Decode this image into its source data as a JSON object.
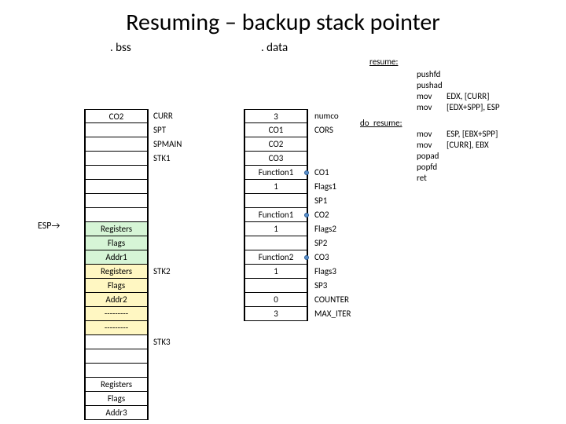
{
  "title": "Resuming – backup stack pointer",
  "sections": {
    "bss": ". bss",
    "data": ". data"
  },
  "esp": "ESP→",
  "bss_cells": [
    {
      "v": "CO2",
      "cls": ""
    },
    {
      "v": "",
      "cls": ""
    },
    {
      "v": "",
      "cls": ""
    },
    {
      "v": "",
      "cls": ""
    },
    {
      "v": "",
      "cls": ""
    },
    {
      "v": "",
      "cls": ""
    },
    {
      "v": "",
      "cls": ""
    },
    {
      "v": "",
      "cls": ""
    },
    {
      "v": "Registers",
      "cls": "green"
    },
    {
      "v": "Flags",
      "cls": "green"
    },
    {
      "v": "Addr1",
      "cls": "green"
    },
    {
      "v": "Registers",
      "cls": "yellow"
    },
    {
      "v": "Flags",
      "cls": "yellow"
    },
    {
      "v": "Addr2",
      "cls": "yellow"
    },
    {
      "v": "---------",
      "cls": "yellow"
    },
    {
      "v": "---------",
      "cls": "yellow"
    },
    {
      "v": "",
      "cls": ""
    },
    {
      "v": "",
      "cls": ""
    },
    {
      "v": "",
      "cls": ""
    },
    {
      "v": "Registers",
      "cls": ""
    },
    {
      "v": "Flags",
      "cls": ""
    },
    {
      "v": "Addr3",
      "cls": ""
    }
  ],
  "bss_right_labels": [
    "CURR",
    "SPT",
    "SPMAIN",
    "STK1",
    "",
    "",
    "",
    "",
    "",
    "",
    "",
    "STK2",
    "",
    "",
    "",
    "",
    "STK3"
  ],
  "data_cells": [
    {
      "v": "3",
      "d": null
    },
    {
      "v": "CO1",
      "d": null
    },
    {
      "v": "CO2",
      "d": null
    },
    {
      "v": "CO3",
      "d": null
    },
    {
      "v": "Function1",
      "d": "r"
    },
    {
      "v": "1",
      "d": null
    },
    {
      "v": "",
      "d": null
    },
    {
      "v": "Function1",
      "d": "r"
    },
    {
      "v": "1",
      "d": null
    },
    {
      "v": "",
      "d": null
    },
    {
      "v": "Function2",
      "d": "r"
    },
    {
      "v": "1",
      "d": null
    },
    {
      "v": "",
      "d": null
    },
    {
      "v": "0",
      "d": null
    },
    {
      "v": "3",
      "d": null
    }
  ],
  "data_right_labels": [
    "numco",
    "CORS",
    "",
    "",
    "CO1",
    "Flags1",
    "SP1",
    "CO2",
    "Flags2",
    "SP2",
    "CO3",
    "Flags3",
    "SP3",
    "COUNTER",
    "MAX_ITER"
  ],
  "code": {
    "resume_label": "resume:",
    "do_resume_label": "do_resume:",
    "block1": [
      {
        "op": "pushfd",
        "args": ""
      },
      {
        "op": "pushad",
        "args": ""
      },
      {
        "op": "mov",
        "args": "EDX, [CURR]"
      },
      {
        "op": "mov",
        "args": "[EDX+SPP], ESP"
      }
    ],
    "block2": [
      {
        "op": "mov",
        "args": "ESP, [EBX+SPP]"
      },
      {
        "op": "mov",
        "args": "[CURR], EBX"
      },
      {
        "op": "popad",
        "args": ""
      },
      {
        "op": "popfd",
        "args": ""
      },
      {
        "op": "ret",
        "args": ""
      }
    ]
  }
}
